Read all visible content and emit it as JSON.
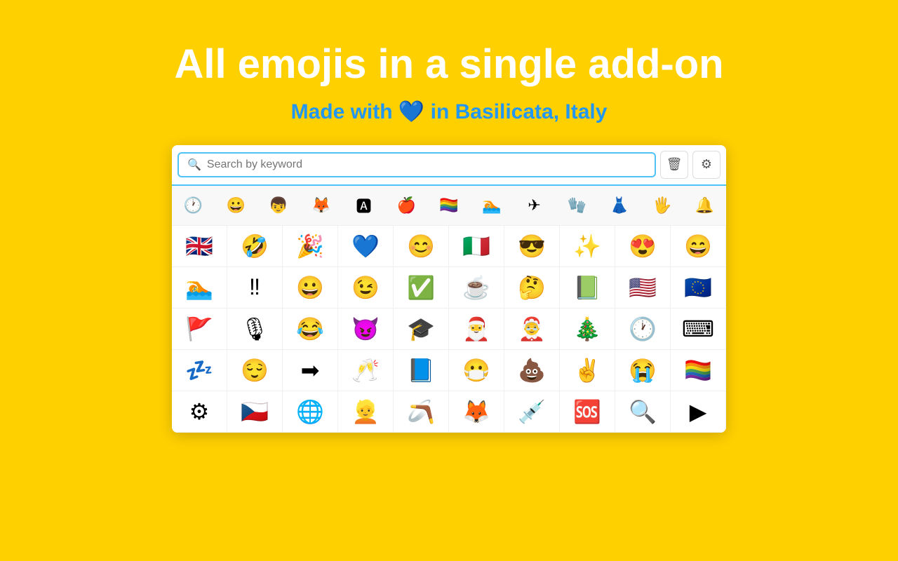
{
  "header": {
    "title": "All emojis in a single add-on",
    "subtitle_prefix": "Made with ",
    "subtitle_heart": "💙",
    "subtitle_suffix": " in Basilicata, Italy"
  },
  "search": {
    "placeholder": "Search by keyword"
  },
  "buttons": {
    "delete_label": "🗑",
    "settings_label": "⚙"
  },
  "categories": [
    "🕐",
    "😀",
    "👦",
    "🦊",
    "🅰",
    "🍎",
    "🏳️‍🌈",
    "🏊",
    "✈",
    "🧤",
    "👗",
    "🖐",
    "🔔"
  ],
  "emojis": [
    "🇬🇧",
    "🤣",
    "🎉",
    "💙",
    "😊",
    "🇮🇹",
    "😎",
    "✨",
    "😍",
    "😄",
    "🏊",
    "‼",
    "😀",
    "😉",
    "✅",
    "☕",
    "🤔",
    "📗",
    "🇺🇸",
    "🇪🇺",
    "🚩",
    "🎙",
    "😂",
    "😈",
    "🎓",
    "🎅",
    "🤶",
    "🎄",
    "🕐",
    "⌨",
    "💤",
    "😌",
    "➡",
    "🥂",
    "📘",
    "😷",
    "💩",
    "✌",
    "😭",
    "🏳️‍🌈",
    "⚙",
    "🇨🇿",
    "🌐",
    "👱",
    "🪃",
    "🦊",
    "💉",
    "🆘",
    "🔍",
    "▶"
  ]
}
